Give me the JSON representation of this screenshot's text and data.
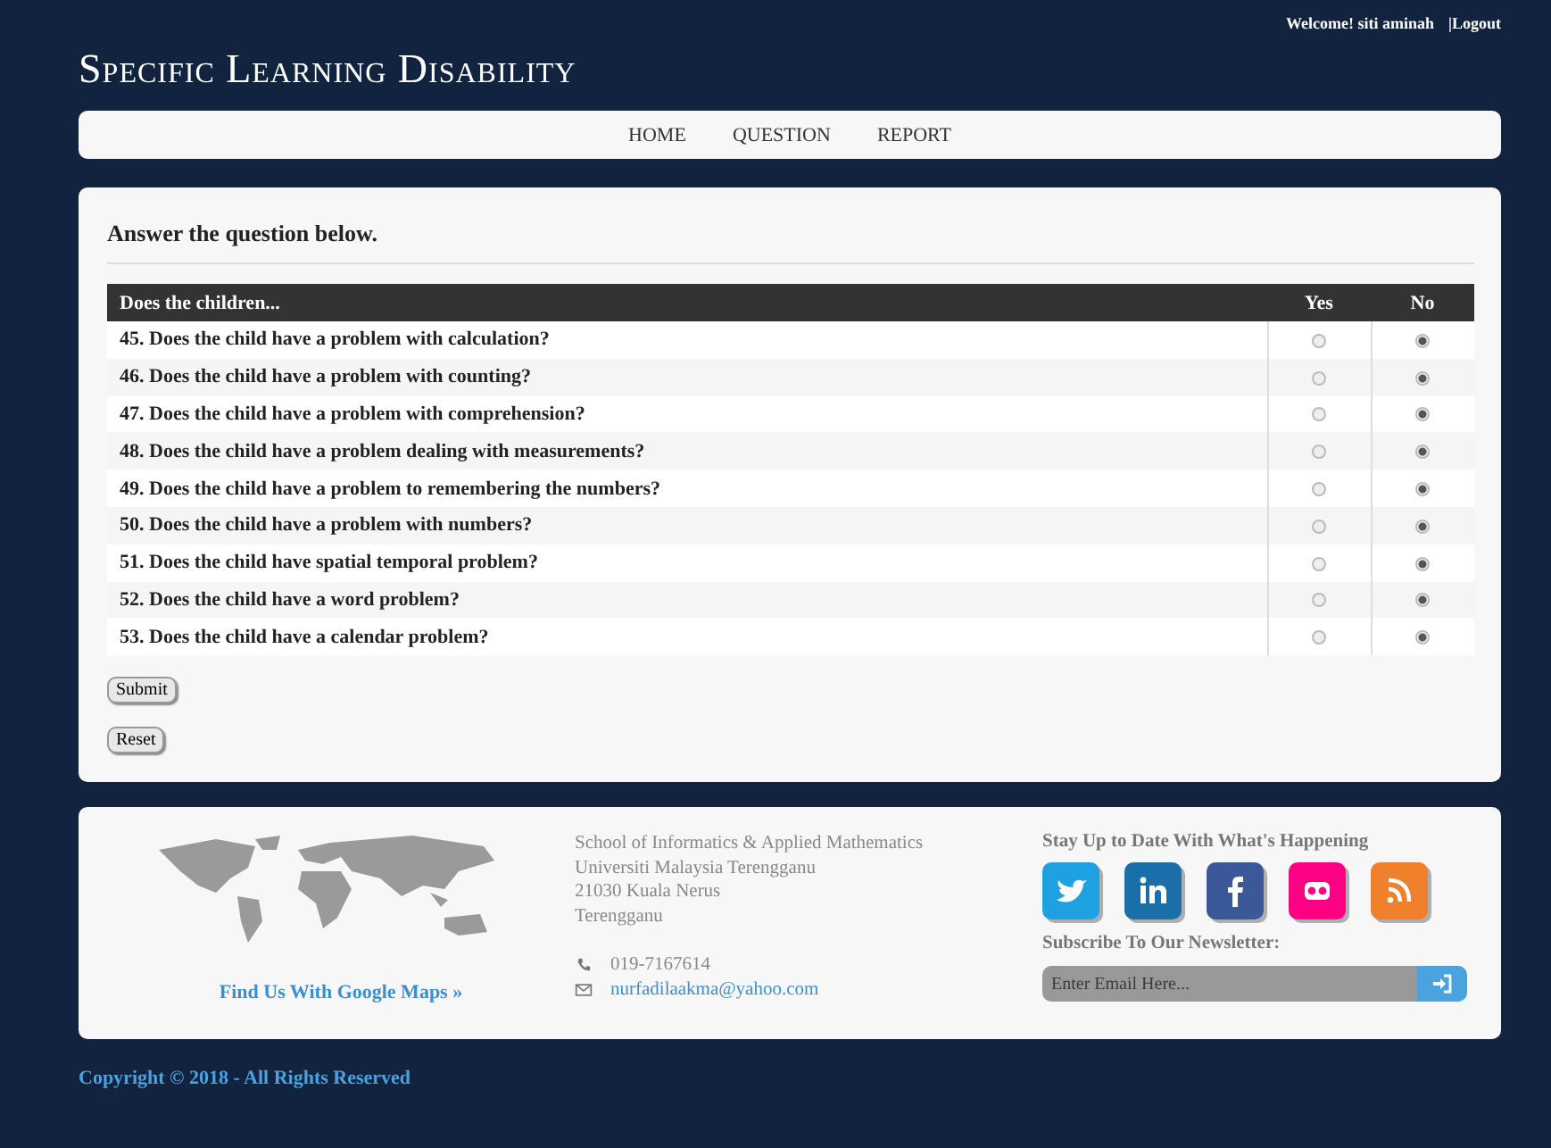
{
  "header": {
    "title": "Specific Learning Disability",
    "welcome": "Welcome! siti aminah",
    "logout": "|Logout"
  },
  "nav": [
    {
      "label": "HOME"
    },
    {
      "label": "QUESTION"
    },
    {
      "label": "REPORT"
    }
  ],
  "form": {
    "heading": "Answer the question below.",
    "columns": [
      "Does the children...",
      "Yes",
      "No"
    ],
    "questions": [
      {
        "text": "45. Does the child have a problem with calculation?",
        "yes": false,
        "no": true
      },
      {
        "text": "46. Does the child have a problem with counting?",
        "yes": false,
        "no": true
      },
      {
        "text": "47. Does the child have a problem with comprehension?",
        "yes": false,
        "no": true
      },
      {
        "text": "48. Does the child have a problem dealing with measurements?",
        "yes": false,
        "no": true
      },
      {
        "text": "49. Does the child have a problem to remembering the numbers?",
        "yes": false,
        "no": true
      },
      {
        "text": "50. Does the child have a problem with numbers?",
        "yes": false,
        "no": true
      },
      {
        "text": "51. Does the child have spatial temporal problem?",
        "yes": false,
        "no": true
      },
      {
        "text": "52. Does the child have a word problem?",
        "yes": false,
        "no": true
      },
      {
        "text": "53. Does the child have a calendar problem?",
        "yes": false,
        "no": true
      }
    ],
    "buttons": [
      "Submit",
      "Reset"
    ]
  },
  "footer": {
    "maps_link": "Find Us With Google Maps »",
    "address": [
      "School of Informatics & Applied Mathematics",
      "Universiti Malaysia Terengganu",
      "21030 Kuala Nerus",
      "Terengganu"
    ],
    "phone": "019-7167614",
    "email": "nurfadilaakma@yahoo.com",
    "social_heading": "Stay Up to Date With What's Happening",
    "social": [
      {
        "kind": "twitter",
        "color": "#1da1e0"
      },
      {
        "kind": "linkedin",
        "color": "#1a6fa8"
      },
      {
        "kind": "facebook",
        "color": "#3b5998"
      },
      {
        "kind": "flickr",
        "color": "#ff0084"
      },
      {
        "kind": "rss",
        "color": "#f0802c"
      }
    ],
    "newsletter_heading": "Subscribe To Our Newsletter:",
    "email_placeholder": "Enter Email Here..."
  },
  "copyright": "Copyright © 2018 - All Rights Reserved"
}
